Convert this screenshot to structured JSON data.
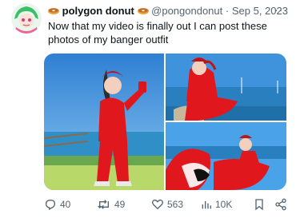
{
  "tweet": {
    "display_name": "polygon donut",
    "handle": "@pongondonut",
    "date": "Sep 5, 2023",
    "text": "Now that my video is finally out I can post these photos of my banger outfit",
    "more": "···"
  },
  "actions": {
    "replies": "40",
    "retweets": "49",
    "likes": "563",
    "views": "10K"
  },
  "colors": {
    "accent_outfit": "#d9171c",
    "sky": "#3a8fd8",
    "water": "#1f6fb2",
    "text_secondary": "#536471"
  }
}
